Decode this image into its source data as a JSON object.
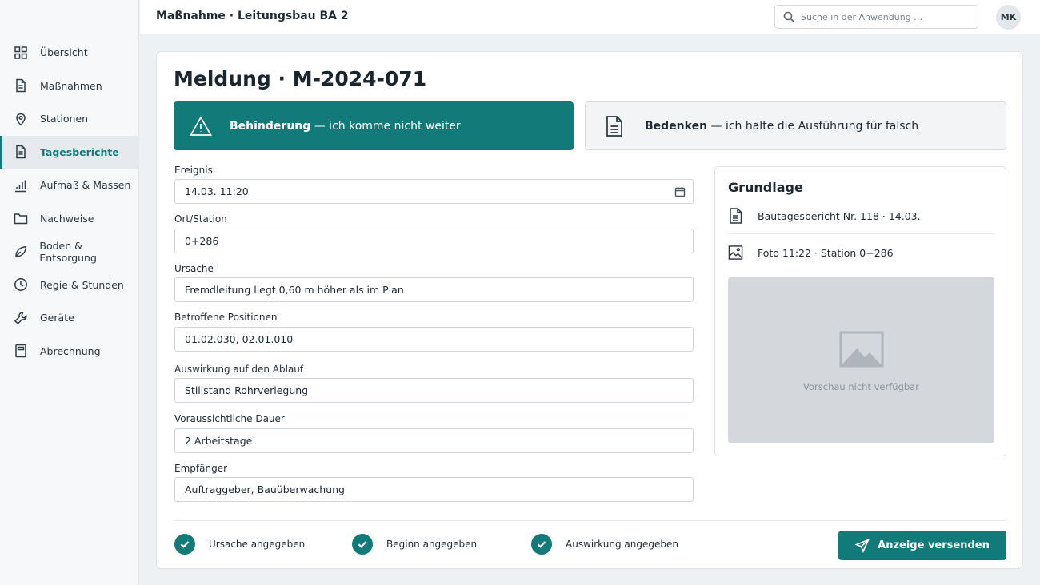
{
  "header": {
    "title": "Maßnahme · Leitungsbau BA 2",
    "search_placeholder": "Suche in der Anwendung …",
    "avatar": "MK"
  },
  "sidebar": {
    "items": [
      {
        "label": "Übersicht",
        "icon": "grid-icon"
      },
      {
        "label": "Maßnahmen",
        "icon": "document-icon"
      },
      {
        "label": "Stationen",
        "icon": "map-pin-icon"
      },
      {
        "label": "Tagesberichte",
        "icon": "document-icon",
        "active": true
      },
      {
        "label": "Aufmaß & Massen",
        "icon": "bar-chart-icon"
      },
      {
        "label": "Nachweise",
        "icon": "folder-icon"
      },
      {
        "label": "Boden & Entsorgung",
        "icon": "leaf-icon"
      },
      {
        "label": "Regie & Stunden",
        "icon": "clock-icon"
      },
      {
        "label": "Geräte",
        "icon": "wrench-icon"
      },
      {
        "label": "Abrechnung",
        "icon": "calculator-icon"
      }
    ]
  },
  "main": {
    "title": "Meldung · M-2024-071",
    "options": {
      "behinderung": {
        "strong": "Behinderung",
        "rest": " — ich komme nicht weiter",
        "icon": "warning-icon",
        "selected": true
      },
      "bedenken": {
        "strong": "Bedenken",
        "rest": " — ich halte die Ausführung für falsch",
        "icon": "document-icon",
        "selected": false
      }
    },
    "fields": {
      "ereignis": {
        "label": "Ereignis",
        "value": "14.03. 11:20"
      },
      "ort": {
        "label": "Ort/Station",
        "value": "0+286"
      },
      "ursache": {
        "label": "Ursache",
        "value": "Fremdleitung liegt 0,60 m höher als im Plan"
      },
      "positionen": {
        "label": "Betroffene Positionen",
        "value": "01.02.030, 02.01.010"
      },
      "auswirkung": {
        "label": "Auswirkung auf den Ablauf",
        "value": "Stillstand Rohrverlegung"
      },
      "dauer": {
        "label": "Voraussichtliche Dauer",
        "value": "2 Arbeitstage"
      },
      "empfaenger": {
        "label": "Empfänger",
        "value": "Auftraggeber, Bauüberwachung"
      }
    },
    "grundlage": {
      "title": "Grundlage",
      "refs": [
        {
          "label": "Bautagesbericht Nr. 118 · 14.03.",
          "icon": "document-icon"
        },
        {
          "label": "Foto 11:22 · Station 0+286",
          "icon": "image-icon"
        }
      ],
      "preview_text": "Vorschau nicht verfügbar"
    },
    "checks": [
      {
        "label": "Ursache angegeben"
      },
      {
        "label": "Beginn angegeben"
      },
      {
        "label": "Auswirkung angegeben"
      }
    ],
    "send_label": "Anzeige versenden"
  },
  "colors": {
    "accent": "#137a7a",
    "preview_bg": "#d4d8dd"
  }
}
